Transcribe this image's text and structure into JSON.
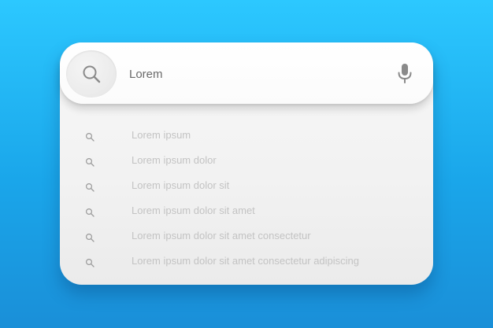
{
  "colors": {
    "background_top": "#2cc8ff",
    "background_bottom": "#1a8fd8",
    "panel": "#f2f2f2",
    "search_bar": "#ffffff",
    "query_text": "#6a6a6a",
    "suggestion_text": "#c3c3c3",
    "icon": "#8a8a8a"
  },
  "search": {
    "value": "Lorem",
    "button_icon": "search-icon",
    "mic_icon": "microphone-icon"
  },
  "suggestions": [
    {
      "icon": "search-icon",
      "label": "Lorem ipsum"
    },
    {
      "icon": "search-icon",
      "label": "Lorem ipsum dolor"
    },
    {
      "icon": "search-icon",
      "label": "Lorem ipsum dolor sit"
    },
    {
      "icon": "search-icon",
      "label": "Lorem ipsum dolor sit amet"
    },
    {
      "icon": "search-icon",
      "label": "Lorem ipsum dolor sit amet consectetur"
    },
    {
      "icon": "search-icon",
      "label": "Lorem ipsum dolor sit amet consectetur adipiscing"
    }
  ]
}
